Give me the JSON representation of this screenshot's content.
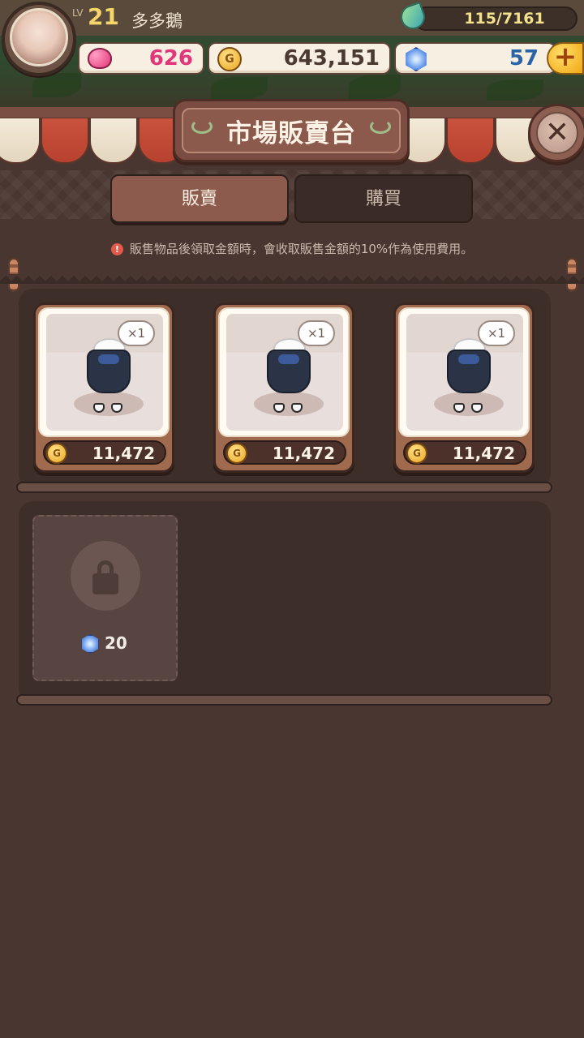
{
  "player": {
    "lv_label": "LV",
    "level": "21",
    "name": "多多鵝"
  },
  "resources": {
    "energy": "115/7161",
    "hearts": "626",
    "coins": "643,151",
    "gems": "57",
    "plus_label": "+"
  },
  "header": {
    "title": "市場販賣台",
    "close_label": "✕"
  },
  "tabs": [
    {
      "label": "販賣",
      "active": true
    },
    {
      "label": "購買",
      "active": false
    }
  ],
  "notice": {
    "icon": "!",
    "text": "販售物品後領取金額時，會收取販售金額的10%作為使用費用。"
  },
  "items": [
    {
      "qty": "×1",
      "price": "11,472",
      "icon": "outfit-icon"
    },
    {
      "qty": "×1",
      "price": "11,472",
      "icon": "outfit-icon"
    },
    {
      "qty": "×1",
      "price": "11,472",
      "icon": "outfit-icon"
    }
  ],
  "locked_slot": {
    "cost": "20",
    "icon": "lock-icon"
  },
  "colors": {
    "background": "#4a3631",
    "tab_active": "#8d5b4d",
    "accent_gold": "#f3d56a",
    "heart": "#e2367a"
  }
}
